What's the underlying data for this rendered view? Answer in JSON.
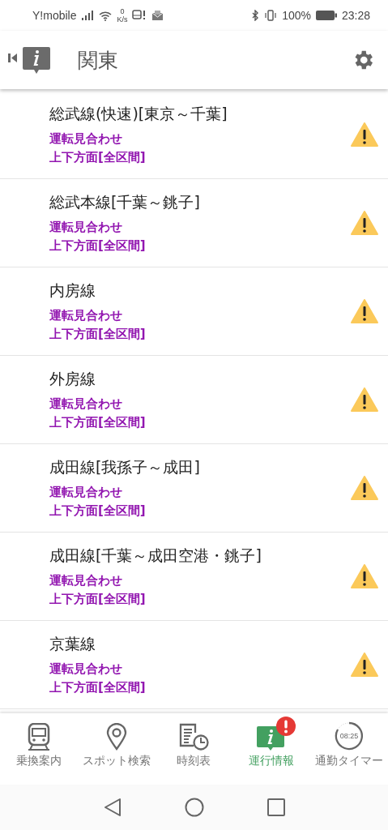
{
  "status_bar": {
    "carrier": "Y!mobile",
    "speed_value": "0",
    "speed_unit": "K/s",
    "battery": "100%",
    "time": "23:28"
  },
  "header": {
    "title": "関東"
  },
  "lines": [
    {
      "name": "総武線(快速)[東京～千葉]",
      "status": "運転見合わせ",
      "section": "上下方面[全区間]",
      "alert": true
    },
    {
      "name": "総武本線[千葉～銚子]",
      "status": "運転見合わせ",
      "section": "上下方面[全区間]",
      "alert": true
    },
    {
      "name": "内房線",
      "status": "運転見合わせ",
      "section": "上下方面[全区間]",
      "alert": true
    },
    {
      "name": "外房線",
      "status": "運転見合わせ",
      "section": "上下方面[全区間]",
      "alert": true
    },
    {
      "name": "成田線[我孫子～成田]",
      "status": "運転見合わせ",
      "section": "上下方面[全区間]",
      "alert": true
    },
    {
      "name": "成田線[千葉～成田空港・銚子]",
      "status": "運転見合わせ",
      "section": "上下方面[全区間]",
      "alert": true
    },
    {
      "name": "京葉線",
      "status": "運転見合わせ",
      "section": "上下方面[全区間]",
      "alert": true
    }
  ],
  "bottom_nav": [
    {
      "kind": "train",
      "label": "乗換案内",
      "selected": false
    },
    {
      "kind": "pin",
      "label": "スポット検索",
      "selected": false
    },
    {
      "kind": "timetable",
      "label": "時刻表",
      "selected": false
    },
    {
      "kind": "info",
      "label": "運行情報",
      "selected": true,
      "badge": true
    },
    {
      "kind": "timer",
      "label": "通勤タイマー",
      "selected": false,
      "icon_text": "08:25"
    }
  ]
}
